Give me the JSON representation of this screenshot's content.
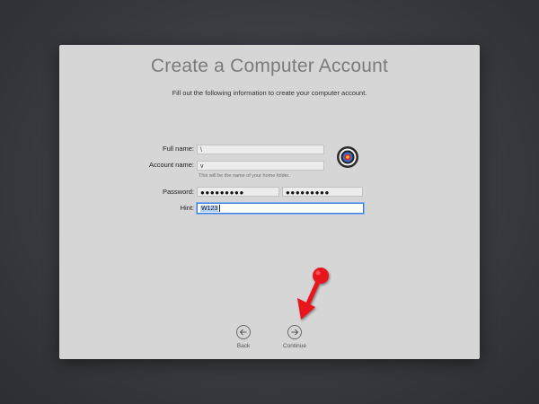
{
  "window": {
    "title": "Create a Computer Account",
    "subtitle": "Fill out the following information to create your computer account."
  },
  "form": {
    "full_name": {
      "label": "Full name:",
      "value": "\\"
    },
    "account_name": {
      "label": "Account name:",
      "value": "v",
      "helper": "This will be the name of your home folder."
    },
    "password": {
      "label": "Password:",
      "value": "●●●●●●●●●",
      "verify_value": "●●●●●●●●●"
    },
    "hint": {
      "label": "Hint:",
      "value": "W123"
    }
  },
  "avatar": {
    "icon": "target-icon"
  },
  "nav": {
    "back_label": "Back",
    "continue_label": "Continue",
    "back_icon": "arrow-left-icon",
    "continue_icon": "arrow-right-icon"
  },
  "colors": {
    "accent": "#3d7bd9",
    "pointer": "#e8141b",
    "window_bg": "#d6d6d6"
  }
}
